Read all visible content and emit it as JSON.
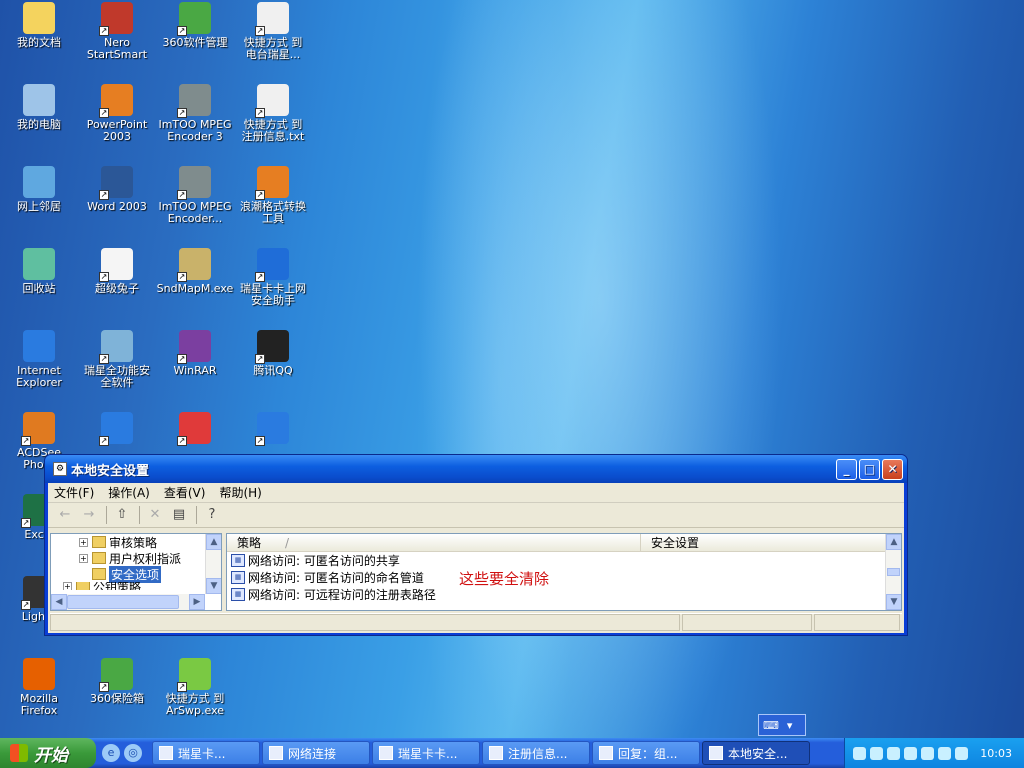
{
  "desktop_icons": [
    {
      "label": "我的文档",
      "color": "#f4d35e",
      "shortcut": false
    },
    {
      "label": "Nero\nStartSmart",
      "color": "#c0392b",
      "shortcut": true
    },
    {
      "label": "360软件管理",
      "color": "#4aa844",
      "shortcut": true
    },
    {
      "label": "快捷方式 到\n电台瑞星...",
      "color": "#f0f0f0",
      "shortcut": true
    },
    {
      "label": "我的电脑",
      "color": "#9ec4e8",
      "shortcut": false
    },
    {
      "label": "PowerPoint\n2003",
      "color": "#e67e22",
      "shortcut": true
    },
    {
      "label": "ImTOO MPEG\nEncoder 3",
      "color": "#7f8c8d",
      "shortcut": true
    },
    {
      "label": "快捷方式 到\n注册信息.txt",
      "color": "#f0f0f0",
      "shortcut": true
    },
    {
      "label": "网上邻居",
      "color": "#5fa8e0",
      "shortcut": false
    },
    {
      "label": "Word 2003",
      "color": "#2b5797",
      "shortcut": true
    },
    {
      "label": "ImTOO MPEG\nEncoder...",
      "color": "#7f8c8d",
      "shortcut": true
    },
    {
      "label": "浪潮格式转换\n工具",
      "color": "#e67e22",
      "shortcut": true
    },
    {
      "label": "回收站",
      "color": "#5fbfa0",
      "shortcut": false
    },
    {
      "label": "超级兔子",
      "color": "#f5f5f5",
      "shortcut": true
    },
    {
      "label": "SndMapM.exe",
      "color": "#c9b26a",
      "shortcut": true
    },
    {
      "label": "瑞星卡卡上网\n安全助手",
      "color": "#1f6dd8",
      "shortcut": true
    },
    {
      "label": "Internet\nExplorer",
      "color": "#2a7be0",
      "shortcut": false
    },
    {
      "label": "瑞星全功能安\n全软件",
      "color": "#7fb3d8",
      "shortcut": true
    },
    {
      "label": "WinRAR",
      "color": "#7b3fa0",
      "shortcut": true
    },
    {
      "label": "腾讯QQ",
      "color": "#222222",
      "shortcut": true
    },
    {
      "label": "ACDSee\nPhoto",
      "color": "#e07a20",
      "shortcut": true
    },
    {
      "label": "",
      "color": "#2a7be0",
      "shortcut": true
    },
    {
      "label": "",
      "color": "#e03a3a",
      "shortcut": true
    },
    {
      "label": "",
      "color": "#2a7be0",
      "shortcut": true
    },
    {
      "label": "Excel",
      "color": "#1e7145",
      "shortcut": true
    },
    {
      "label": "LightS",
      "color": "#333333",
      "shortcut": true
    },
    {
      "label": "Mozilla\nFirefox",
      "color": "#e66000",
      "shortcut": false
    },
    {
      "label": "360保险箱",
      "color": "#4aa844",
      "shortcut": true
    },
    {
      "label": "快捷方式 到\nArSwp.exe",
      "color": "#7ac943",
      "shortcut": true
    }
  ],
  "window": {
    "title": "本地安全设置",
    "menu": [
      "文件(F)",
      "操作(A)",
      "查看(V)",
      "帮助(H)"
    ],
    "tree": [
      "审核策略",
      "用户权利指派",
      "安全选项",
      "公钥策略"
    ],
    "columns": {
      "policy": "策略",
      "setting": "安全设置"
    },
    "rows": [
      "网络访问: 可匿名访问的共享",
      "网络访问: 可匿名访问的命名管道",
      "网络访问: 可远程访问的注册表路径"
    ],
    "annotation": "这些要全清除",
    "annotation_color": "#d01010"
  },
  "taskbar": {
    "start_label": "开始",
    "tasks": [
      "瑞星卡...",
      "网络连接",
      "瑞星卡卡...",
      "注册信息...",
      "回复：组...",
      "本地安全..."
    ],
    "active_task": "本地安全...",
    "clock": "10:03"
  }
}
